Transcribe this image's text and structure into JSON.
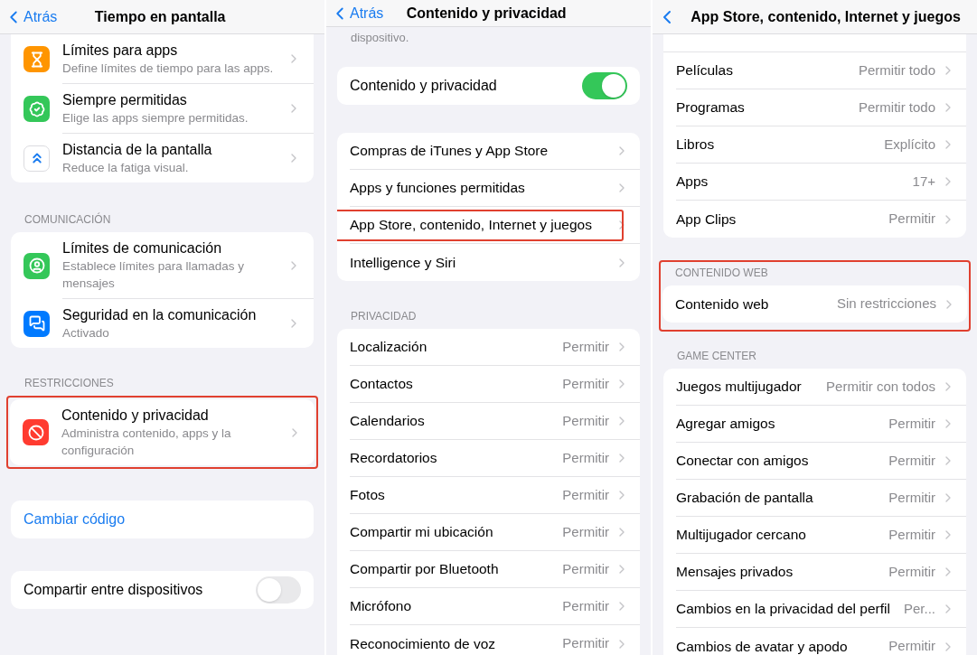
{
  "panels": [
    {
      "title": "Tiempo en pantalla",
      "back_label": "Atrás",
      "groups": [
        {
          "highlighted": false,
          "rows": [
            {
              "kind": "icon_nav",
              "label": "Límites para apps",
              "subtitle": "Define límites de tiempo para las apps.",
              "color": "#ff9500"
            },
            {
              "kind": "icon_nav",
              "label": "Siempre permitidas",
              "subtitle": "Elige las apps siempre permitidas.",
              "color": "#34c759"
            },
            {
              "kind": "icon_nav",
              "label": "Distancia de la pantalla",
              "subtitle": "Reduce la fatiga visual.",
              "color": "#ffffff"
            }
          ]
        },
        {
          "header": "COMUNICACIÓN",
          "highlighted": false,
          "rows": [
            {
              "kind": "icon_nav",
              "label": "Límites de comunicación",
              "subtitle": "Establece límites para llamadas y mensajes",
              "color": "#34c759"
            },
            {
              "kind": "icon_nav",
              "label": "Seguridad en la comunicación",
              "subtitle": "Activado",
              "color": "#007aff"
            }
          ]
        },
        {
          "header": "RESTRICCIONES",
          "highlighted": true,
          "rows": [
            {
              "kind": "icon_nav",
              "label": "Contenido y privacidad",
              "subtitle": "Administra contenido, apps y la configuración",
              "color": "#ff3b30"
            }
          ]
        },
        {
          "highlighted": false,
          "rows": [
            {
              "kind": "link",
              "label": "Cambiar código"
            }
          ]
        },
        {
          "highlighted": false,
          "rows": [
            {
              "kind": "toggle",
              "label": "Compartir entre dispositivos",
              "on": false
            }
          ]
        }
      ]
    },
    {
      "title": "Contenido y privacidad",
      "back_label": "Atrás",
      "note": "dispositivo.",
      "groups": [
        {
          "highlighted": false,
          "rows": [
            {
              "kind": "toggle",
              "label": "Contenido y privacidad",
              "on": true
            }
          ]
        },
        {
          "highlighted": false,
          "rows": [
            {
              "kind": "nav",
              "label": "Compras de iTunes y App Store",
              "highlighted": false
            },
            {
              "kind": "nav",
              "label": "Apps y funciones permitidas",
              "highlighted": false
            },
            {
              "kind": "nav",
              "label": "App Store, contenido, Internet y juegos",
              "highlighted": true
            },
            {
              "kind": "nav",
              "label": "Intelligence y Siri",
              "highlighted": false
            }
          ]
        },
        {
          "header": "PRIVACIDAD",
          "highlighted": false,
          "rows": [
            {
              "kind": "nav",
              "label": "Localización",
              "value": "Permitir",
              "highlighted": false
            },
            {
              "kind": "nav",
              "label": "Contactos",
              "value": "Permitir",
              "highlighted": false
            },
            {
              "kind": "nav",
              "label": "Calendarios",
              "value": "Permitir",
              "highlighted": false
            },
            {
              "kind": "nav",
              "label": "Recordatorios",
              "value": "Permitir",
              "highlighted": false
            },
            {
              "kind": "nav",
              "label": "Fotos",
              "value": "Permitir",
              "highlighted": false
            },
            {
              "kind": "nav",
              "label": "Compartir mi ubicación",
              "value": "Permitir",
              "highlighted": false
            },
            {
              "kind": "nav",
              "label": "Compartir por Bluetooth",
              "value": "Permitir",
              "highlighted": false
            },
            {
              "kind": "nav",
              "label": "Micrófono",
              "value": "Permitir",
              "highlighted": false
            },
            {
              "kind": "nav",
              "label": "Reconocimiento de voz",
              "value": "Permitir",
              "highlighted": false
            }
          ]
        }
      ]
    },
    {
      "title": "App Store, contenido, Internet y juegos",
      "groups": [
        {
          "highlighted": false,
          "rows": [
            {
              "kind": "nav",
              "label": "Películas",
              "value": "Permitir todo",
              "highlighted": false
            },
            {
              "kind": "nav",
              "label": "Programas",
              "value": "Permitir todo",
              "highlighted": false
            },
            {
              "kind": "nav",
              "label": "Libros",
              "value": "Explícito",
              "highlighted": false
            },
            {
              "kind": "nav",
              "label": "Apps",
              "value": "17+",
              "highlighted": false
            },
            {
              "kind": "nav",
              "label": "App Clips",
              "value": "Permitir",
              "highlighted": false
            }
          ]
        },
        {
          "header": "CONTENIDO WEB",
          "highlighted": true,
          "rows": [
            {
              "kind": "nav",
              "label": "Contenido web",
              "value": "Sin restricciones",
              "highlighted": false
            }
          ]
        },
        {
          "header": "GAME CENTER",
          "highlighted": false,
          "rows": [
            {
              "kind": "nav",
              "label": "Juegos multijugador",
              "value": "Permitir con todos",
              "highlighted": false
            },
            {
              "kind": "nav",
              "label": "Agregar amigos",
              "value": "Permitir",
              "highlighted": false
            },
            {
              "kind": "nav",
              "label": "Conectar con amigos",
              "value": "Permitir",
              "highlighted": false
            },
            {
              "kind": "nav",
              "label": "Grabación de pantalla",
              "value": "Permitir",
              "highlighted": false
            },
            {
              "kind": "nav",
              "label": "Multijugador cercano",
              "value": "Permitir",
              "highlighted": false
            },
            {
              "kind": "nav",
              "label": "Mensajes privados",
              "value": "Permitir",
              "highlighted": false
            },
            {
              "kind": "nav",
              "label": "Cambios en la privacidad del perfil",
              "value": "Per...",
              "highlighted": false
            },
            {
              "kind": "nav",
              "label": "Cambios de avatar y apodo",
              "value": "Permitir",
              "highlighted": false
            }
          ]
        }
      ]
    }
  ]
}
